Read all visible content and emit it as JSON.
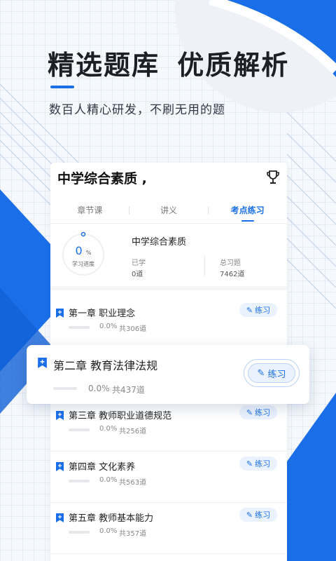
{
  "promo": {
    "headline": "精选题库 优质解析",
    "subtitle": "数百人精心研发，不刷无用的题"
  },
  "card": {
    "title": "中学综合素质 ,",
    "tabs": [
      {
        "label": "章节课"
      },
      {
        "label": "讲义"
      },
      {
        "label": "考点练习"
      }
    ],
    "progress": {
      "percent_value": "0",
      "percent_unit": "%",
      "label": "学习进度",
      "subject": "中学综合素质",
      "learned_label": "已学",
      "learned_value": "0道",
      "total_label": "总习题",
      "total_value": "7462道"
    },
    "chapters": [
      {
        "name": "第一章 职业理念",
        "percent": "0.0%",
        "total": "共306道",
        "button": "练习"
      },
      {
        "name": "第二章 教育法律法规",
        "percent": "0.0%",
        "total": "共437道",
        "button": "练习"
      },
      {
        "name": "第三章 教师职业道德规范",
        "percent": "0.0%",
        "total": "共256道",
        "button": "练习"
      },
      {
        "name": "第四章 文化素养",
        "percent": "0.0%",
        "total": "共563道",
        "button": "练习"
      },
      {
        "name": "第五章 教师基本能力",
        "percent": "0.0%",
        "total": "共357道",
        "button": "练习"
      }
    ]
  },
  "colors": {
    "accent": "#1a6fe8",
    "button_bg": "#eaf2fd"
  },
  "icons": [
    "bookmark-plus-icon",
    "trophy-icon",
    "pencil-icon"
  ]
}
